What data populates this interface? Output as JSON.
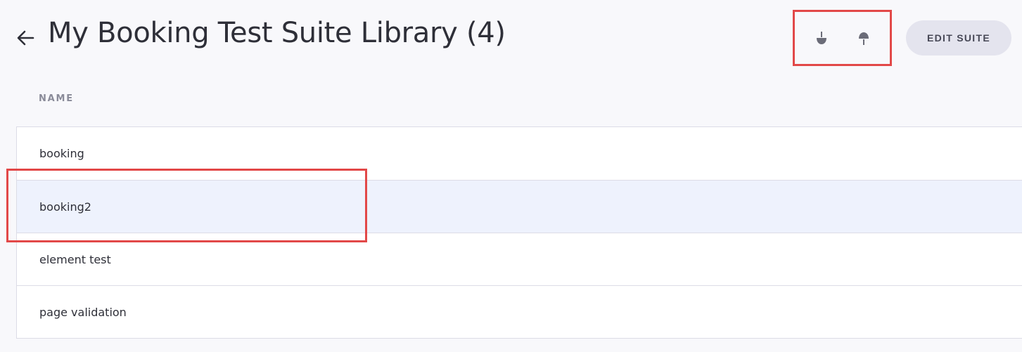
{
  "header": {
    "back_icon": "arrow-left-icon",
    "title": "My Booking Test Suite Library (4)",
    "move_down_icon": "move-down-icon",
    "move_up_icon": "move-up-icon",
    "edit_label": "EDIT SUITE"
  },
  "table": {
    "column_header": "NAME",
    "rows": [
      {
        "name": "booking",
        "selected": false
      },
      {
        "name": "booking2",
        "selected": true
      },
      {
        "name": "element test",
        "selected": false
      },
      {
        "name": "page validation",
        "selected": false
      }
    ]
  },
  "colors": {
    "background": "#f8f8fb",
    "selected_row": "#eef2fd",
    "highlight_border": "#e24848",
    "button_bg": "#e4e4ee"
  }
}
